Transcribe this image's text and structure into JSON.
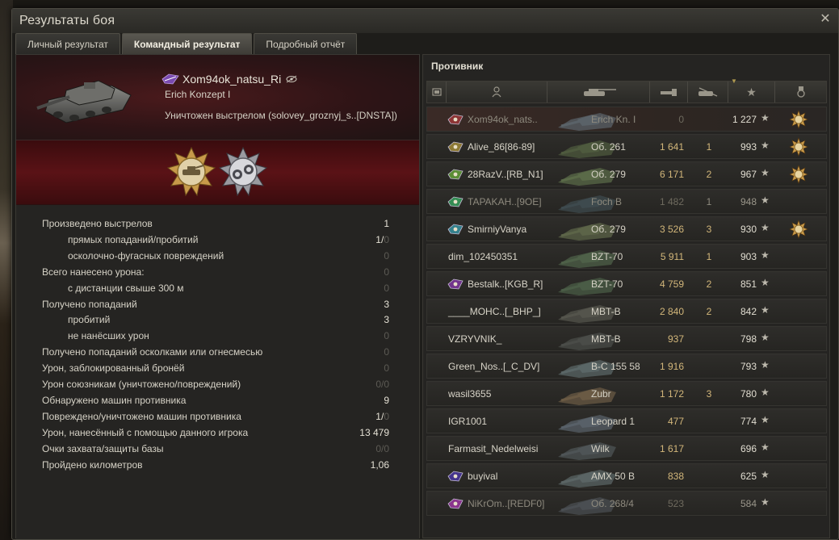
{
  "window": {
    "title": "Результаты боя"
  },
  "tabs": [
    {
      "label": "Личный результат",
      "active": false
    },
    {
      "label": "Командный результат",
      "active": true
    },
    {
      "label": "Подробный отчёт",
      "active": false
    }
  ],
  "player": {
    "name": "Xom94ok_natsu_Ri",
    "vehicle": "Erich Konzept I",
    "status": "Уничтожен выстрелом (solovey_groznyj_s..[DNSTA])"
  },
  "stats": [
    {
      "label": "Произведено выстрелов",
      "value": "1",
      "indent": false
    },
    {
      "label": "прямых попаданий/пробитий",
      "value": "1/",
      "zero": "0",
      "indent": true
    },
    {
      "label": "осколочно-фугасных повреждений",
      "value": "",
      "zero": "0",
      "indent": true
    },
    {
      "label": "Всего нанесено урона:",
      "value": "",
      "zero": "0",
      "indent": false
    },
    {
      "label": "с дистанции свыше 300 м",
      "value": "",
      "zero": "0",
      "indent": true
    },
    {
      "label": "Получено попаданий",
      "value": "3",
      "indent": false
    },
    {
      "label": "пробитий",
      "value": "3",
      "indent": true
    },
    {
      "label": "не нанёсших урон",
      "value": "",
      "zero": "0",
      "indent": true
    },
    {
      "label": "Получено попаданий осколками или огнесмесью",
      "value": "",
      "zero": "0",
      "indent": false
    },
    {
      "label": "Урон, заблокированный бронёй",
      "value": "",
      "zero": "0",
      "indent": false
    },
    {
      "label": "Урон союзникам (уничтожено/повреждений)",
      "value": "",
      "zero": "0/0",
      "indent": false
    },
    {
      "label": "Обнаружено машин противника",
      "value": "9",
      "indent": false
    },
    {
      "label": "Повреждено/уничтожено машин противника",
      "value": "1/",
      "zero": "0",
      "indent": false
    },
    {
      "label": "Урон, нанесённый с помощью данного игрока",
      "value": "13 479",
      "indent": false
    },
    {
      "label": "Очки захвата/защиты базы",
      "value": "",
      "zero": "0/0",
      "indent": false
    },
    {
      "label": "Пройдено километров",
      "value": "1,06",
      "indent": false
    }
  ],
  "enemy": {
    "title": "Противник",
    "rows": [
      {
        "name": "Xom94ok_nats..",
        "clan": true,
        "vehicle": "Erich Kn. I",
        "damage": "0",
        "kills": "",
        "xp": "1 227",
        "medal": true,
        "state": "self"
      },
      {
        "name": "Alive_86[86-89]",
        "clan": true,
        "vehicle": "Об. 261",
        "damage": "1 641",
        "kills": "1",
        "xp": "993",
        "medal": true,
        "state": "alive"
      },
      {
        "name": "28RazV..[RB_N1]",
        "clan": true,
        "vehicle": "Об. 279",
        "damage": "6 171",
        "kills": "2",
        "xp": "967",
        "medal": true,
        "state": "alive"
      },
      {
        "name": "TAPAKAH..[9OE]",
        "clan": true,
        "vehicle": "Foch B",
        "damage": "1 482",
        "kills": "1",
        "xp": "948",
        "medal": false,
        "state": "dead"
      },
      {
        "name": "SmirniyVanya",
        "clan": true,
        "vehicle": "Об. 279",
        "damage": "3 526",
        "kills": "3",
        "xp": "930",
        "medal": true,
        "state": "alive"
      },
      {
        "name": "dim_102450351",
        "clan": false,
        "vehicle": "BZT-70",
        "damage": "5 911",
        "kills": "1",
        "xp": "903",
        "medal": false,
        "state": "alive"
      },
      {
        "name": "Bestalk..[KGB_R]",
        "clan": true,
        "vehicle": "BZT-70",
        "damage": "4 759",
        "kills": "2",
        "xp": "851",
        "medal": false,
        "state": "alive"
      },
      {
        "name": "____MOHC..[_BHP_]",
        "clan": false,
        "vehicle": "MBT-B",
        "damage": "2 840",
        "kills": "2",
        "xp": "842",
        "medal": false,
        "state": "alive"
      },
      {
        "name": "VZRYVNIK_",
        "clan": false,
        "vehicle": "MBT-B",
        "damage": "937",
        "kills": "",
        "xp": "798",
        "medal": false,
        "state": "alive"
      },
      {
        "name": "Green_Nos..[_C_DV]",
        "clan": false,
        "vehicle": "B-C 155 58",
        "damage": "1 916",
        "kills": "",
        "xp": "793",
        "medal": false,
        "state": "alive"
      },
      {
        "name": "wasil3655",
        "clan": false,
        "vehicle": "Zubr",
        "damage": "1 172",
        "kills": "3",
        "xp": "780",
        "medal": false,
        "state": "alive"
      },
      {
        "name": "IGR1001",
        "clan": false,
        "vehicle": "Leopard 1",
        "damage": "477",
        "kills": "",
        "xp": "774",
        "medal": false,
        "state": "alive"
      },
      {
        "name": "Farmasit_Nedelweisi",
        "clan": false,
        "vehicle": "Wilk",
        "damage": "1 617",
        "kills": "",
        "xp": "696",
        "medal": false,
        "state": "alive"
      },
      {
        "name": "buyival",
        "clan": true,
        "vehicle": "AMX 50 B",
        "damage": "838",
        "kills": "",
        "xp": "625",
        "medal": false,
        "state": "alive"
      },
      {
        "name": "NiKrOm..[REDF0]",
        "clan": true,
        "vehicle": "Об. 268/4",
        "damage": "523",
        "kills": "",
        "xp": "584",
        "medal": false,
        "state": "dead"
      }
    ]
  },
  "colors": {
    "header_red": "#4a1a1c",
    "damage_gold": "#d2b67a",
    "dim_text": "#5c5a54"
  }
}
